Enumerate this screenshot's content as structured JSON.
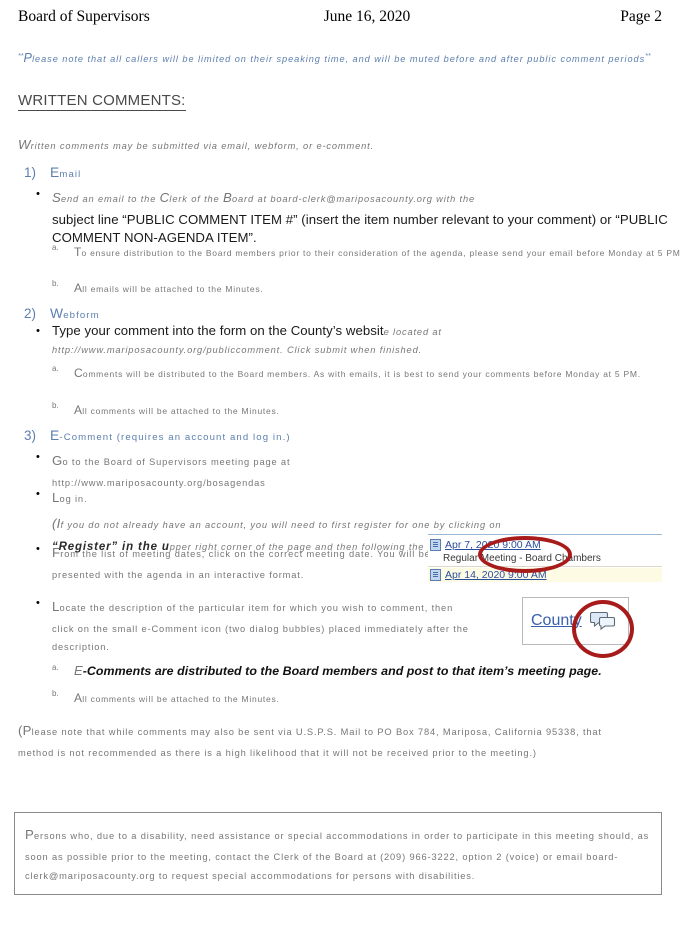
{
  "header": {
    "left": "Board of Supervisors",
    "center": "June 16, 2020",
    "right": "Page 2"
  },
  "notice": {
    "stars_open": "**",
    "lead_cap": "P",
    "text": "lease note that all callers will be limited on their speaking time, and will be muted before and after public comment periods",
    "stars_close": "**"
  },
  "section": {
    "title": "WRITTEN COMMENTS:"
  },
  "intro": {
    "cap": "W",
    "text": "ritten comments may be submitted via email, webform, or e-comment."
  },
  "items": {
    "email": {
      "number": "1)",
      "cap": "E",
      "label": "mail",
      "bullet_grey_cap": "S",
      "bullet_grey": "end an email to the ",
      "bullet_grey_cap2": "C",
      "bullet_grey2": "lerk of the ",
      "bullet_grey_cap3": "B",
      "bullet_grey3": "oard at board-clerk@mariposacounty.org with the",
      "bullet_black": "subject line “PUBLIC COMMENT ITEM #” (insert the item number relevant to your comment) or “PUBLIC COMMENT NON-AGENDA ITEM”.",
      "sub_a_letter": "a.",
      "sub_a_cap": "T",
      "sub_a": "o ensure distribution to the Board members prior to their consideration of the agenda, please send your email before Monday at 5 PM.",
      "sub_b_letter": "b.",
      "sub_b_cap": "A",
      "sub_b": "ll emails will be attached to the Minutes."
    },
    "webform": {
      "number": "2)",
      "cap": "W",
      "label": "ebform",
      "bullet_black": "Type your comment into the form on the County’s websit",
      "bullet_grey_tail": "e located at",
      "bullet_line2": "http://www.mariposacounty.org/publiccomment. Click submit when finished.",
      "sub_a_letter": "a.",
      "sub_a_cap": "C",
      "sub_a": "omments will be distributed to the Board members. As with emails, it is best to send your comments before Monday at 5 PM.",
      "sub_b_letter": "b.",
      "sub_b_cap": "A",
      "sub_b": "ll comments will be attached to the Minutes."
    },
    "ecomment": {
      "number": "3)",
      "cap": "E",
      "label": "-Comment",
      "paren": "(requires an account and log in.)",
      "b1_cap": "G",
      "b1": "o to the Board of Supervisors meeting page at",
      "b1_url": "http://www.mariposacounty.org/bosagendas",
      "b2_cap": "L",
      "b2": "og in.",
      "b2_note_open": "(I",
      "b2_note": "f you do not already have an account, you will need to first register for one by clicking on ",
      "b2_note_bold": "“Register” in the u",
      "b2_note_tail": "pper right corner of the page and then following the prompts.)",
      "b3_cap": "F",
      "b3": "rom the list of meeting dates, click on the correct meeting date. You will be presented with the agenda in an interactive format.",
      "b4_cap": "L",
      "b4": "ocate the description of the particular item for which you wish to comment, then click on the small e-Comment icon (two dialog bubbles) placed immediately after the description.",
      "sub_a_letter": "a.",
      "sub_a_cap": "E",
      "sub_a": "-Comments are distributed to the Board members and post to that item’s meeting page.",
      "sub_b_letter": "b.",
      "sub_b_cap": "A",
      "sub_b": "ll comments will be attached to the Minutes."
    }
  },
  "usps": {
    "open": "(P",
    "text": "lease note that while comments may also be sent via U.S.P.S. Mail to PO Box 784, Mariposa, California 95338, that method is not recommended as there is a high likelihood that it will not be received prior to the meeting.)"
  },
  "ada": {
    "cap": "P",
    "text": "ersons who, due to a disability, need assistance or special accommodations in order to participate in this meeting should, as soon as possible prior to the meeting, contact the Clerk of the Board at (209) 966-3222, option 2 (voice) or email board-clerk@mariposacounty.org to request special accommodations for persons with disabilities."
  },
  "screenshot_meetings": {
    "rows": [
      {
        "date": "Apr 7, 2020 9:00 AM",
        "sub": "Regular Meeting - Board Chambers"
      },
      {
        "date": "Apr 14, 2020 9:00 AM",
        "sub": ""
      }
    ]
  },
  "screenshot_county": {
    "link": "County",
    "icon": "ecomment-bubbles-icon"
  },
  "annotations": {
    "color": "#a81b1b",
    "marks": [
      "ellipse-around-meeting-date",
      "ellipse-around-ecomment-icon"
    ]
  }
}
